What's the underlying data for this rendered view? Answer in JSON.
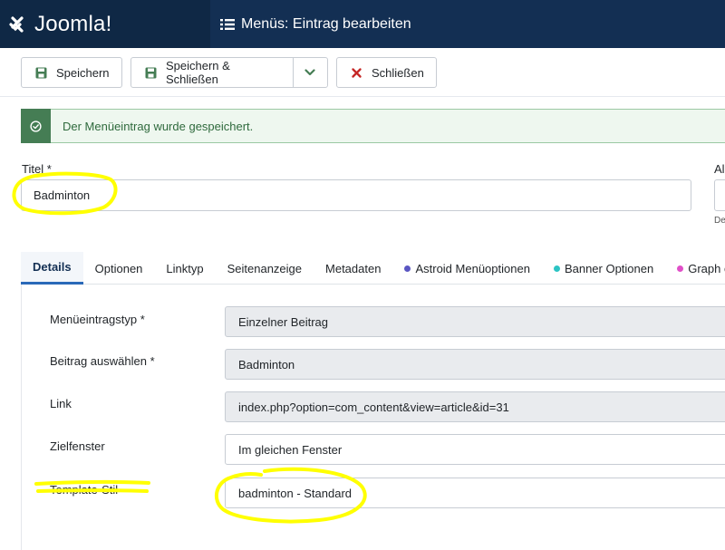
{
  "header": {
    "brand": "Joomla!",
    "page_title": "Menüs: Eintrag bearbeiten"
  },
  "toolbar": {
    "save_label": "Speichern",
    "save_close_label": "Speichern & Schließen",
    "close_label": "Schließen"
  },
  "alert": {
    "message": "Der Menüeintrag wurde gespeichert."
  },
  "title_field": {
    "label": "Titel *",
    "value": "Badminton"
  },
  "alias_field": {
    "label": "Al",
    "hint": "De"
  },
  "tabs": [
    {
      "label": "Details"
    },
    {
      "label": "Optionen"
    },
    {
      "label": "Linktyp"
    },
    {
      "label": "Seitenanzeige"
    },
    {
      "label": "Metadaten"
    },
    {
      "label": "Astroid Menüoptionen"
    },
    {
      "label": "Banner Optionen"
    },
    {
      "label": "Graph öf"
    }
  ],
  "details": {
    "menu_item_type": {
      "label": "Menüeintragstyp *",
      "value": "Einzelner Beitrag"
    },
    "select_article": {
      "label": "Beitrag auswählen *",
      "value": "Badminton"
    },
    "link": {
      "label": "Link",
      "value": "index.php?option=com_content&view=article&id=31"
    },
    "target_window": {
      "label": "Zielfenster",
      "value": "Im gleichen Fenster"
    },
    "template_style": {
      "label": "Template-Stil",
      "value": "badminton - Standard"
    }
  },
  "colors": {
    "header_bg": "#132f53",
    "brand_bg": "#0f2845",
    "success_green": "#457d54",
    "close_red": "#c52827",
    "active_tab": "#2a69b8",
    "astroid_dot": "#5a56c2",
    "banner_dot": "#2cc4c4",
    "graph_dot": "#e04fc8",
    "highlighter": "#ffff00"
  }
}
